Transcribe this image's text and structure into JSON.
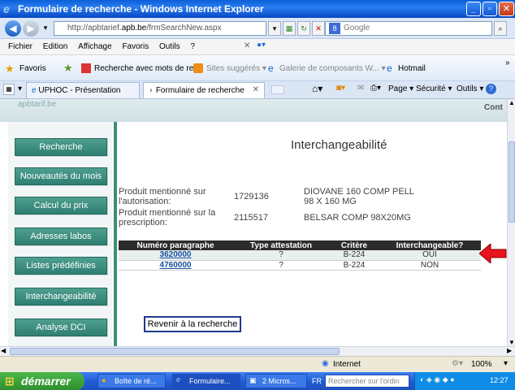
{
  "window": {
    "title": "Formulaire de recherche - Windows Internet Explorer",
    "min": "_",
    "max": "▫",
    "close": "✕"
  },
  "address": {
    "url_prefix": "http://apbtarief.",
    "url_domain": "apb.be",
    "url_path": "/frmSearchNew.aspx",
    "search_placeholder": "Google"
  },
  "menu": [
    "Fichier",
    "Edition",
    "Affichage",
    "Favoris",
    "Outils",
    "?"
  ],
  "favorites": {
    "label": "Favoris",
    "items": [
      "Recherche avec mots de re...",
      "Sites suggérés ▾",
      "Galerie de composants W... ▾",
      "Hotmail"
    ]
  },
  "tabs": [
    {
      "label": "UPHOC - Présentation"
    },
    {
      "label": "Formulaire de recherche"
    }
  ],
  "toolbar": {
    "page": "Page ▾",
    "security": "Sécurité ▾",
    "tools": "Outils ▾",
    "help": "?"
  },
  "page": {
    "logo_text": "apbtarif.be",
    "top_right": "Cont",
    "heading": "Interchangeabilité",
    "sidebar": [
      "Recherche",
      "Nouveautés du mois",
      "Calcul du prix",
      "Adresses labos",
      "Listes prédéfinies",
      "Interchangeabilité",
      "Analyse DCI"
    ],
    "product_authorisation": {
      "label": "Produit mentionné sur l'autorisation:",
      "code": "1729136",
      "name": "DIOVANE 160 COMP PELL 98 X 160 MG"
    },
    "product_prescription": {
      "label": "Produit mentionné sur la prescription:",
      "code": "2115517",
      "name": "BELSAR COMP 98X20MG"
    },
    "table": {
      "headers": [
        "Numéro paragraphe",
        "Type attestation",
        "Critère",
        "Interchangeable?"
      ],
      "rows": [
        [
          "3620000",
          "?",
          "B-224",
          "OUI"
        ],
        [
          "4760000",
          "?",
          "B-224",
          "NON"
        ]
      ]
    },
    "back_button": "Revenir à la recherche"
  },
  "status": {
    "zone": "Internet",
    "zoom": "100%"
  },
  "taskbar": {
    "start": "démarrer",
    "tasks": [
      "Boîte de ré...",
      "Formulaire...",
      "2 Micros..."
    ],
    "lang": "FR",
    "search_placeholder": "Rechercher sur l'ordin",
    "clock": "12:27"
  },
  "colors": {
    "sidebar_btn": "#3a8a7c",
    "table_header": "#2c2c2c",
    "arrow": "#e8141e",
    "divider": "#3b8f78"
  }
}
